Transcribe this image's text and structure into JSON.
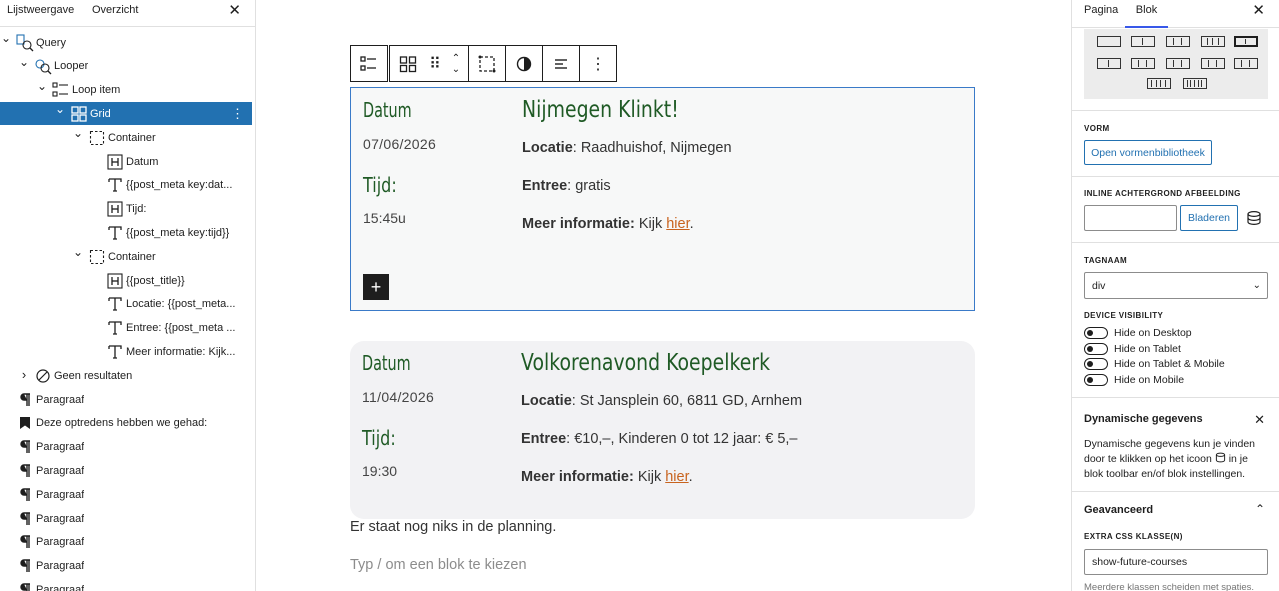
{
  "left_panel": {
    "tabs": [
      "Lijstweergave",
      "Overzicht"
    ],
    "close_icon": "close-icon",
    "tree": [
      {
        "label": "Query",
        "icon": "query-icon",
        "chevron": "down"
      },
      {
        "label": "Looper",
        "icon": "looper-icon",
        "chevron": "down"
      },
      {
        "label": "Loop item",
        "icon": "loop-item-icon",
        "chevron": "down"
      },
      {
        "label": "Grid",
        "icon": "grid-icon",
        "chevron": "down",
        "selected": true
      },
      {
        "label": "Container",
        "icon": "container-icon",
        "chevron": "down"
      },
      {
        "label": "Datum",
        "icon": "heading-icon"
      },
      {
        "label": "{{post_meta key:dat...",
        "icon": "text-icon"
      },
      {
        "label": "Tijd:",
        "icon": "heading-icon"
      },
      {
        "label": "{{post_meta key:tijd}}",
        "icon": "text-icon"
      },
      {
        "label": "Container",
        "icon": "container-icon",
        "chevron": "down"
      },
      {
        "label": "{{post_title}}",
        "icon": "heading-icon"
      },
      {
        "label": "Locatie: {{post_meta...",
        "icon": "text-icon"
      },
      {
        "label": "Entree: {{post_meta ...",
        "icon": "text-icon"
      },
      {
        "label": "Meer informatie: Kijk...",
        "icon": "text-icon"
      },
      {
        "label": "Geen resultaten",
        "icon": "no-results-icon",
        "chevron": "right"
      },
      {
        "label": "Paragraaf",
        "icon": "paragraph-icon"
      },
      {
        "label": "Deze optredens hebben we gehad:",
        "icon": "bookmark-icon"
      },
      {
        "label": "Paragraaf",
        "icon": "paragraph-icon"
      },
      {
        "label": "Paragraaf",
        "icon": "paragraph-icon"
      },
      {
        "label": "Paragraaf",
        "icon": "paragraph-icon"
      },
      {
        "label": "Paragraaf",
        "icon": "paragraph-icon"
      },
      {
        "label": "Paragraaf",
        "icon": "paragraph-icon"
      },
      {
        "label": "Paragraaf",
        "icon": "paragraph-icon"
      },
      {
        "label": "Paragraaf",
        "icon": "paragraph-icon"
      }
    ]
  },
  "canvas": {
    "cards": [
      {
        "datum_label": "Datum",
        "date": "07/06/2026",
        "tijd_label": "Tijd:",
        "time": "15:45u",
        "title": "Nijmegen Klinkt!",
        "locatie_label": "Locatie",
        "locatie_value": ": Raadhuishof, Nijmegen",
        "entree_label": "Entree",
        "entree_value": ": gratis",
        "meer_label": "Meer informatie:",
        "meer_value": " Kijk ",
        "link": "hier",
        "link_suffix": "."
      },
      {
        "datum_label": "Datum",
        "date": "11/04/2026",
        "tijd_label": "Tijd:",
        "time": "19:30",
        "title": "Volkorenavond Koepelkerk",
        "locatie_label": "Locatie",
        "locatie_value": ": St Jansplein 60, 6811 GD, Arnhem",
        "entree_label": "Entree",
        "entree_value": ": €10,–, Kinderen 0 tot 12 jaar: € 5,–",
        "meer_label": "Meer informatie:",
        "meer_value": " Kijk ",
        "link": "hier",
        "link_suffix": "."
      }
    ],
    "no_more_text": "Er staat nog niks in de planning.",
    "placeholder": "Typ / om een blok te kiezen",
    "add_label": "+"
  },
  "right_panel": {
    "tabs": [
      "Pagina",
      "Blok"
    ],
    "active_tab": "Blok",
    "vorm_heading": "VORM",
    "vorm_button": "Open vormenbibliotheek",
    "inline_bg_heading": "INLINE ACHTERGROND AFBEELDING",
    "browse_button": "Bladeren",
    "tagnaam_heading": "TAGNAAM",
    "tagnaam_value": "div",
    "device_heading": "DEVICE VISIBILITY",
    "toggles": [
      "Hide on Desktop",
      "Hide on Tablet",
      "Hide on Tablet & Mobile",
      "Hide on Mobile"
    ],
    "dynamic_title": "Dynamische gegevens",
    "dynamic_help_1": "Dynamische gegevens kun je vinden door te klikken op het icoon",
    "dynamic_help_2": "in je blok toolbar en/of blok instellingen.",
    "advanced_title": "Geavanceerd",
    "css_heading": "EXTRA CSS KLASSE(N)",
    "css_value": "show-future-courses",
    "css_note": "Meerdere klassen scheiden met spaties."
  },
  "colors": {
    "accent": "#2271b1",
    "heading_green": "#1f5a25",
    "link_orange": "#c8631e",
    "selection_blue": "#2271b1"
  }
}
